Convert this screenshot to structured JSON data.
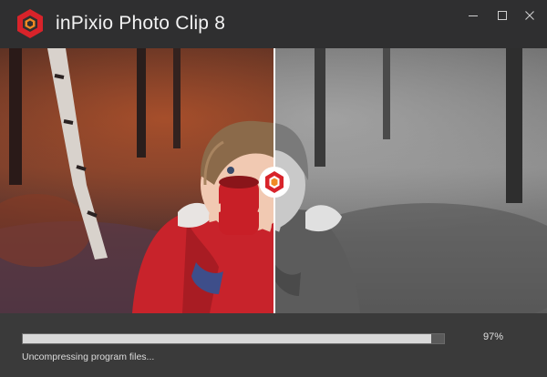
{
  "window": {
    "title": "inPixio Photo Clip 8"
  },
  "controls": {
    "minimize": "minimize-icon",
    "maximize": "maximize-icon",
    "close": "close-icon"
  },
  "progress": {
    "percent_text": "97%",
    "fraction": 0.97,
    "status": "Uncompressing program files..."
  },
  "colors": {
    "brand_red": "#d8232a",
    "titlebar": "#2f2f30",
    "background": "#3a3a3a",
    "progress_fill": "#d9d9d9",
    "progress_track": "#5a5a5a"
  }
}
